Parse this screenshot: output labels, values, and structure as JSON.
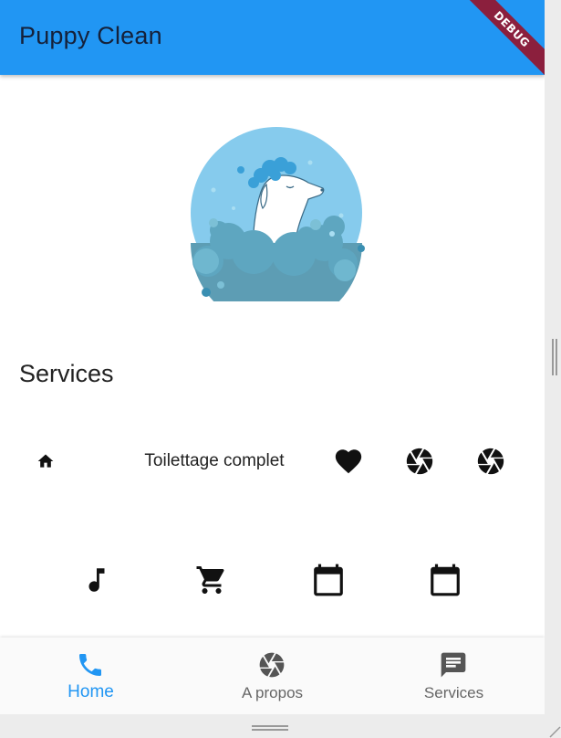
{
  "app": {
    "title": "Puppy Clean",
    "debug_banner": "DEBUG",
    "colors": {
      "primary": "#2196f3",
      "ribbon": "#8b1f3d",
      "text": "#222222"
    }
  },
  "hero": {
    "icon": "dog-bath-illustration"
  },
  "services": {
    "title": "Services",
    "row1": [
      {
        "icon": "home-icon"
      },
      {
        "label": "Toilettage complet"
      },
      {
        "icon": "heart-icon"
      },
      {
        "icon": "camera-shutter-icon"
      },
      {
        "icon": "camera-shutter-icon"
      }
    ],
    "row2": [
      {
        "icon": "music-note-icon"
      },
      {
        "icon": "shopping-cart-icon"
      },
      {
        "icon": "calendar-icon"
      },
      {
        "icon": "calendar-icon"
      }
    ]
  },
  "bottom_nav": {
    "items": [
      {
        "label": "Home",
        "icon": "phone-icon",
        "active": true
      },
      {
        "label": "A propos",
        "icon": "camera-shutter-icon",
        "active": false
      },
      {
        "label": "Services",
        "icon": "chat-icon",
        "active": false
      }
    ]
  }
}
